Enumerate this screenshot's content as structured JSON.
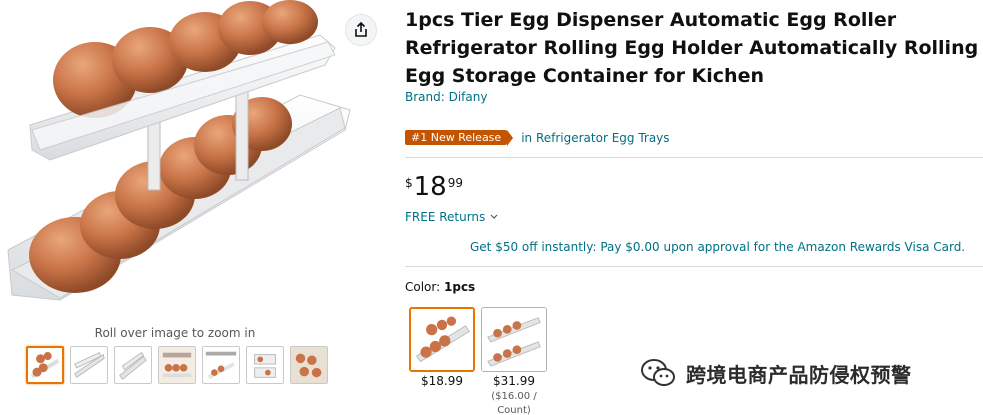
{
  "product": {
    "title": "1pcs Tier Egg Dispenser Automatic Egg Roller Refrigerator Rolling Egg Holder Automatically Rolling Egg Storage Container for Kichen",
    "brand": "Brand: Difany",
    "badge": "#1 New Release",
    "category": "in Refrigerator Egg Trays",
    "price": {
      "symbol": "$",
      "whole": "18",
      "fraction": "99"
    },
    "returns": "FREE Returns",
    "promo": "Get $50 off instantly: Pay $0.00 upon approval for the Amazon Rewards Visa Card.",
    "color_label": "Color:",
    "color_value": "1pcs"
  },
  "gallery": {
    "zoom_hint": "Roll over image to zoom in",
    "thumbnail_count": 7,
    "active_thumbnail": 0
  },
  "variants": [
    {
      "price": "$18.99",
      "sub": "",
      "selected": true
    },
    {
      "price": "$31.99",
      "sub": "($16.00 / Count)",
      "selected": false
    }
  ],
  "watermark": {
    "text": "跨境电商产品防侵权预警",
    "icon": "wechat-icon"
  },
  "icons": {
    "share": "share-icon",
    "chevron": "chevron-down-icon"
  },
  "colors": {
    "accent": "#e77600",
    "link": "#007185",
    "badge": "#c45500"
  }
}
